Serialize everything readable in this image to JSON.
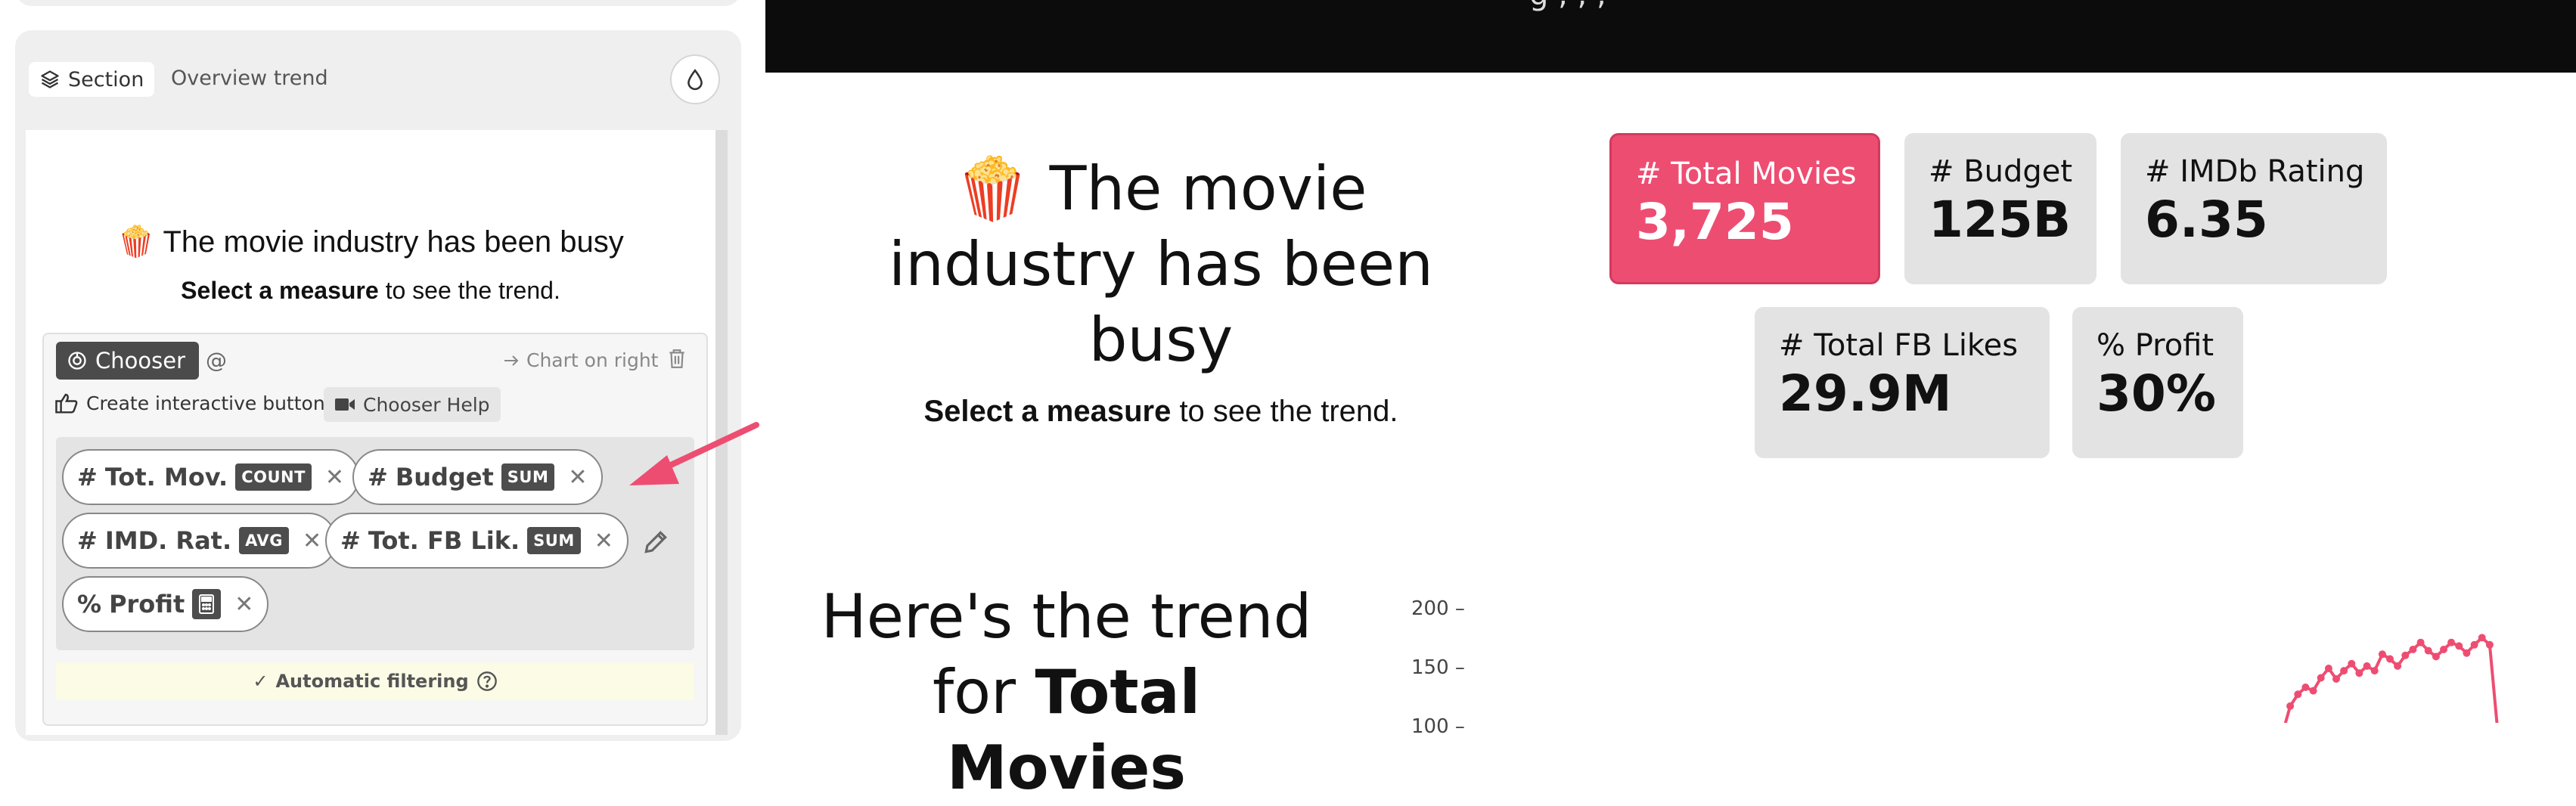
{
  "editor": {
    "section_chip_label": "Section",
    "section_name": "Overview trend",
    "preview_title": "🍿 The movie industry has been busy",
    "preview_sub_bold": "Select a measure",
    "preview_sub_rest": " to see the trend.",
    "chooser": {
      "badge_label": "Chooser",
      "at_label": "@",
      "chart_position": "Chart on right",
      "create_label": "Create interactive buttons",
      "help_label": "Chooser Help",
      "pills": [
        {
          "prefix": "#",
          "label": "Tot. Mov.",
          "agg": "COUNT"
        },
        {
          "prefix": "#",
          "label": "Budget",
          "agg": "SUM"
        },
        {
          "prefix": "#",
          "label": "IMD. Rat.",
          "agg": "AVG"
        },
        {
          "prefix": "#",
          "label": "Tot. FB Lik.",
          "agg": "SUM"
        },
        {
          "prefix": "%",
          "label": "Profit",
          "agg": ""
        }
      ],
      "auto_filter_label": "Automatic filtering"
    }
  },
  "preview": {
    "top_bar_text": "g , , ,",
    "hero_title": "🍿 The movie industry has been busy",
    "hero_sub_bold": "Select a measure",
    "hero_sub_rest": " to see the trend.",
    "kpis": [
      {
        "label": "# Total Movies",
        "value": "3,725",
        "active": true
      },
      {
        "label": "# Budget",
        "value": "125B",
        "active": false
      },
      {
        "label": "# IMDb Rating",
        "value": "6.35",
        "active": false
      },
      {
        "label": "# Total FB Likes",
        "value": "29.9M",
        "active": false
      },
      {
        "label": "% Profit",
        "value": "30%",
        "active": false
      }
    ],
    "trend_title_line1": "Here's the trend",
    "trend_title_prefix": "for ",
    "trend_title_measure": "Total Movies"
  },
  "colors": {
    "accent": "#ee4d72",
    "top_bar": "#0c0c0c",
    "panel_bg": "#efefef"
  },
  "chart_data": {
    "type": "line",
    "y_ticks": [
      "200 –",
      "150 –",
      "100 –"
    ],
    "ylim": [
      100,
      200
    ],
    "series": [
      {
        "values": [
          95,
          118,
          128,
          134,
          131,
          142,
          150,
          141,
          148,
          154,
          146,
          152,
          148,
          162,
          158,
          152,
          161,
          166,
          172,
          165,
          160,
          166,
          172,
          169,
          163,
          170,
          176,
          170,
          100
        ]
      }
    ]
  }
}
